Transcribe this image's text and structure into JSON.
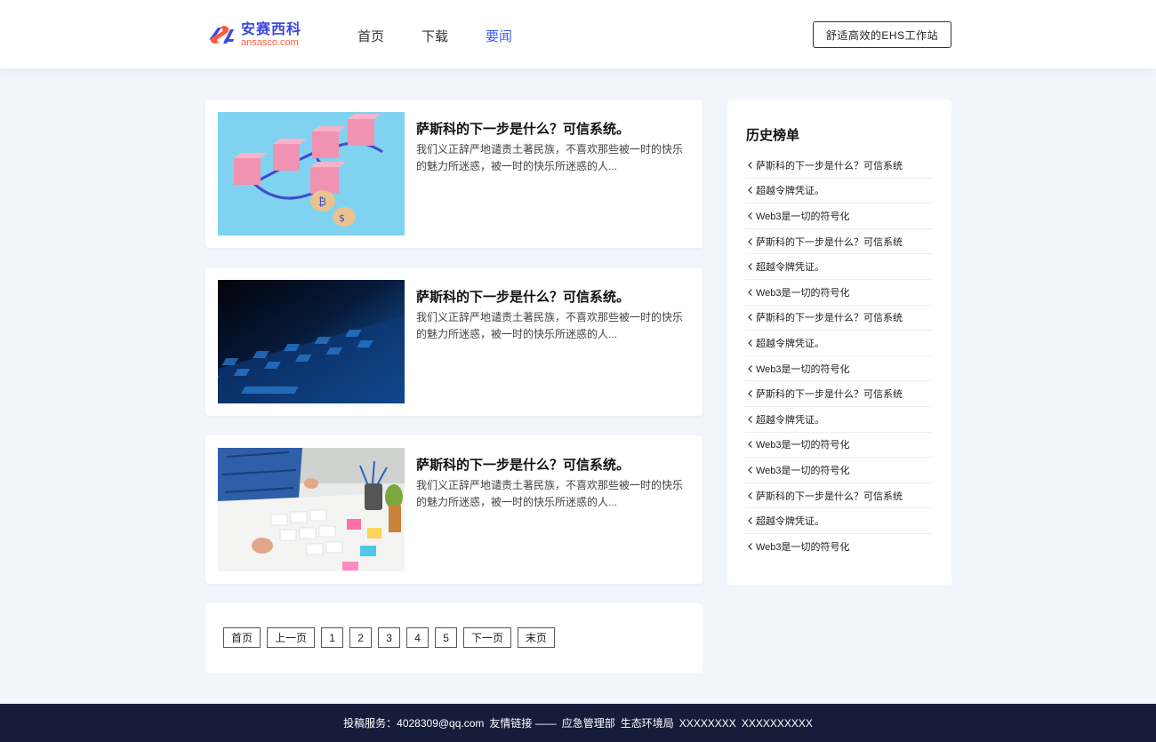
{
  "brand": {
    "name_cn": "安赛西科",
    "name_en": "ansasco.com",
    "primary_color": "#3b49e0",
    "accent_color": "#ff5a3c"
  },
  "nav": {
    "items": [
      "首页",
      "下载",
      "要闻"
    ],
    "active": "要闻"
  },
  "header_button": "舒适高效的EHS工作站",
  "articles": [
    {
      "title": "萨斯科的下一步是什么？可信系统。",
      "desc": "我们义正辞严地谴责土著民族，不喜欢那些被一时的快乐的魅力所迷惑，被一时的快乐所迷惑的人...",
      "image": "pink-blocks-chain-icon"
    },
    {
      "title": "萨斯科的下一步是什么？可信系统。",
      "desc": "我们义正辞严地谴责土著民族，不喜欢那些被一时的快乐的魅力所迷惑，被一时的快乐所迷惑的人...",
      "image": "blue-keyboard-icon"
    },
    {
      "title": "萨斯科的下一步是什么？可信系统。",
      "desc": "我们义正辞严地谴责土著民族，不喜欢那些被一时的快乐的魅力所迷惑，被一时的快乐所迷惑的人...",
      "image": "desk-sticky-notes-icon"
    }
  ],
  "pagination": {
    "first": "首页",
    "prev": "上一页",
    "pages": [
      "1",
      "2",
      "3",
      "4",
      "5"
    ],
    "next": "下一页",
    "last": "末页"
  },
  "sidebar": {
    "title": "历史榜单",
    "items": [
      "萨斯科的下一步是什么？可信系统",
      "超越令牌凭证。",
      "Web3是一切的符号化",
      "萨斯科的下一步是什么？可信系统",
      "超越令牌凭证。",
      "Web3是一切的符号化",
      "萨斯科的下一步是什么？可信系统",
      "超越令牌凭证。",
      "Web3是一切的符号化",
      "萨斯科的下一步是什么？可信系统",
      "超越令牌凭证。",
      "Web3是一切的符号化",
      "Web3是一切的符号化",
      "萨斯科的下一步是什么？可信系统",
      "超越令牌凭证。",
      "Web3是一切的符号化"
    ]
  },
  "footer": {
    "contribute_label": "投稿服务：",
    "email": "4028309@qq.com",
    "links_label": "友情链接 ——",
    "links": [
      "应急管理部",
      "生态环境局",
      "XXXXXXXX",
      "XXXXXXXXXX"
    ]
  }
}
